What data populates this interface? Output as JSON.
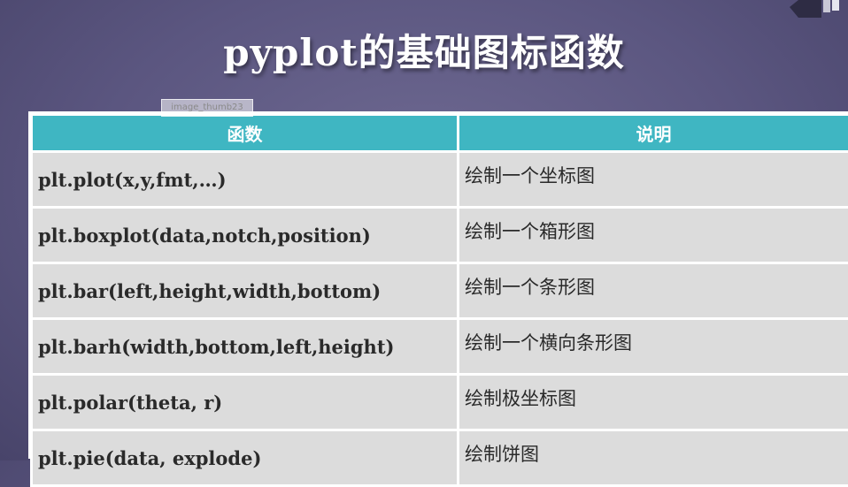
{
  "title": "pyplot的基础图标函数",
  "thumb_label": "image_thumb23",
  "table": {
    "headers": [
      "函数",
      "说明"
    ],
    "rows": [
      {
        "func": "plt.plot(x,y,fmt,…)",
        "desc": "绘制一个坐标图"
      },
      {
        "func": "plt.boxplot(data,notch,position)",
        "desc": "绘制一个箱形图"
      },
      {
        "func": "plt.bar(left,height,width,bottom)",
        "desc": "绘制一个条形图"
      },
      {
        "func": "plt.barh(width,bottom,left,height)",
        "desc": "绘制一个横向条形图"
      },
      {
        "func": "plt.polar(theta, r)",
        "desc": "绘制极坐标图"
      },
      {
        "func": "plt.pie(data, explode)",
        "desc": "绘制饼图"
      }
    ]
  },
  "colors": {
    "header_bg": "#3fb6c2",
    "row_bg": "#dcdcdc",
    "slide_bg": "#5b5680"
  }
}
